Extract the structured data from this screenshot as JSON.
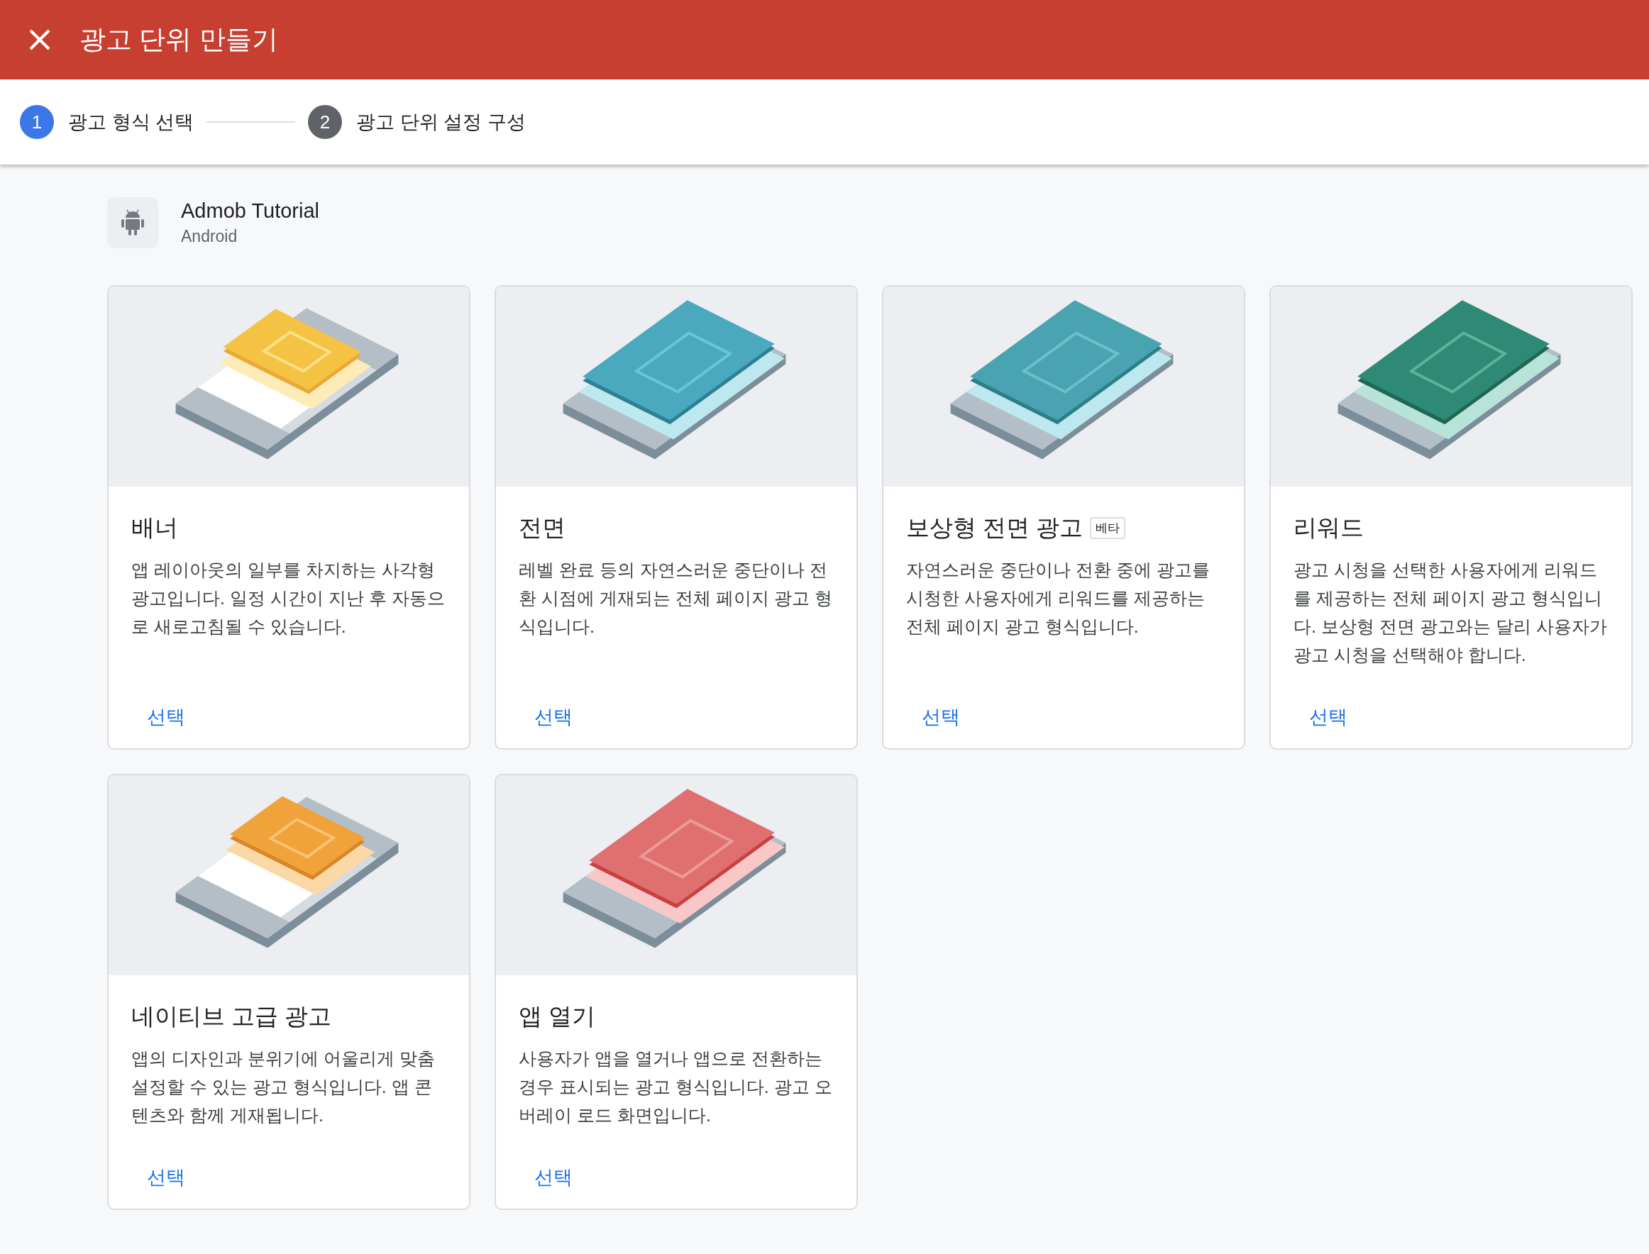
{
  "header": {
    "title": "광고 단위 만들기"
  },
  "steps": [
    {
      "number": "1",
      "label": "광고 형식 선택",
      "selected": true
    },
    {
      "number": "2",
      "label": "광고 단위 설정 구성",
      "selected": false
    }
  ],
  "app": {
    "name": "Admob Tutorial",
    "platform": "Android"
  },
  "formats": [
    {
      "title": "배너",
      "description": "앱 레이아웃의 일부를 차지하는 사각형 광고입니다. 일정 시간이 지난 후 자동으로 새로고침될 수 있습니다.",
      "action": "선택"
    },
    {
      "title": "전면",
      "description": "레벨 완료 등의 자연스러운 중단이나 전환 시점에 게재되는 전체 페이지 광고 형식입니다.",
      "action": "선택"
    },
    {
      "title": "보상형 전면 광고",
      "badge": "베타",
      "description": "자연스러운 중단이나 전환 중에 광고를 시청한 사용자에게 리워드를 제공하는 전체 페이지 광고 형식입니다.",
      "action": "선택"
    },
    {
      "title": "리워드",
      "description": "광고 시청을 선택한 사용자에게 리워드를 제공하는 전체 페이지 광고 형식입니다. 보상형 전면 광고와는 달리 사용자가 광고 시청을 선택해야 합니다.",
      "action": "선택"
    },
    {
      "title": "네이티브 고급 광고",
      "description": "앱의 디자인과 분위기에 어울리게 맞춤 설정할 수 있는 광고 형식입니다. 앱 콘텐츠와 함께 게재됩니다.",
      "action": "선택"
    },
    {
      "title": "앱 열기",
      "description": "사용자가 앱을 열거나 앱으로 전환하는 경우 표시되는 광고 형식입니다. 광고 오버레이 로드 화면입니다.",
      "action": "선택"
    }
  ]
}
